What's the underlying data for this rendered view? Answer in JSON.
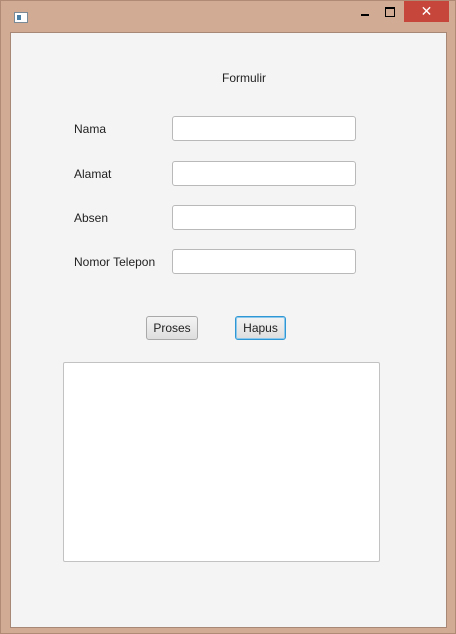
{
  "window": {
    "minimize_icon": "minimize-icon",
    "maximize_icon": "maximize-icon",
    "close_glyph": "✕",
    "close_color": "#c7463b",
    "frame_color": "#d1ab93"
  },
  "form": {
    "title": "Formulir",
    "fields": [
      {
        "label": "Nama",
        "value": "",
        "placeholder": ""
      },
      {
        "label": "Alamat",
        "value": "",
        "placeholder": ""
      },
      {
        "label": "Absen",
        "value": "",
        "placeholder": ""
      },
      {
        "label": "Nomor Telepon",
        "value": "",
        "placeholder": ""
      }
    ],
    "buttons": {
      "proses": "Proses",
      "hapus": "Hapus"
    },
    "output": ""
  }
}
